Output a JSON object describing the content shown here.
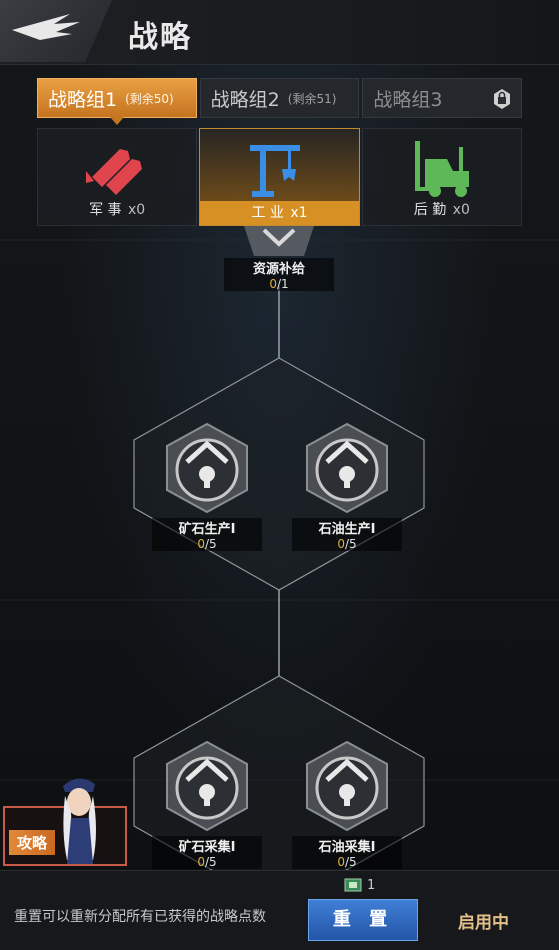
{
  "header": {
    "title": "战略"
  },
  "tabs": [
    {
      "name": "战略组1",
      "remain": "(剩余50)"
    },
    {
      "name": "战略组2",
      "remain": "(剩余51)"
    },
    {
      "name": "战略组3",
      "remain": ""
    }
  ],
  "categories": [
    {
      "label": "军 事",
      "count": "x0",
      "icon": "missile-icon",
      "color": "#e0454e"
    },
    {
      "label": "工 业",
      "count": "x1",
      "icon": "crane-icon",
      "color": "#3a8ee6"
    },
    {
      "label": "后 勤",
      "count": "x0",
      "icon": "forklift-icon",
      "color": "#5fb858"
    }
  ],
  "nodes": {
    "top": {
      "label": "资源补给",
      "current": "0",
      "total": "/1"
    },
    "mid_left": {
      "label": "矿石生产Ⅰ",
      "current": "0",
      "total": "/5"
    },
    "mid_right": {
      "label": "石油生产Ⅰ",
      "current": "0",
      "total": "/5"
    },
    "bot_left": {
      "label": "矿石采集Ⅰ",
      "current": "0",
      "total": "/5"
    },
    "bot_right": {
      "label": "石油采集Ⅰ",
      "current": "0",
      "total": "/5"
    }
  },
  "guide": {
    "label": "攻略"
  },
  "bottom": {
    "points": "1",
    "hint": "重置可以重新分配所有已获得的战略点数",
    "reset": "重 置",
    "status": "启用中"
  }
}
